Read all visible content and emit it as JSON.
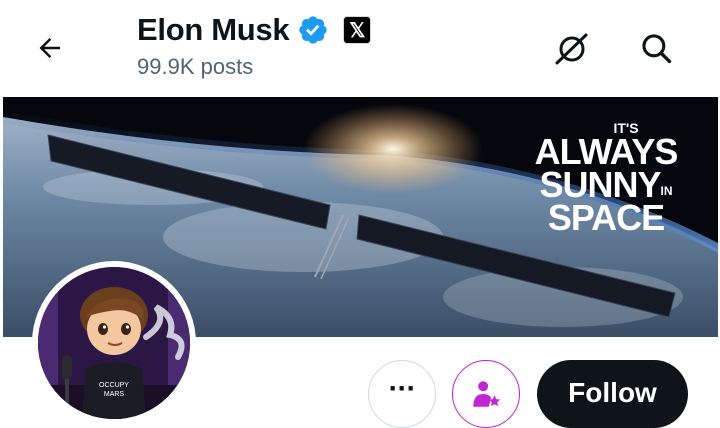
{
  "header": {
    "name": "Elon Musk",
    "posts": "99.9K posts",
    "x_badge": "𝕏"
  },
  "banner": {
    "line1": "IT'S",
    "line2": "ALWAYS",
    "line3": "SUNNY",
    "line3_small": "IN",
    "line4": "SPACE"
  },
  "actions": {
    "more": "···",
    "follow": "Follow"
  },
  "icons": {
    "back": "arrow-left-icon",
    "verified": "verified-badge-icon",
    "grok": "grok-icon",
    "search": "search-icon",
    "subscribe": "subscribe-star-person-icon"
  },
  "colors": {
    "verified": "#1d9bf0",
    "follow_bg": "#0f1419",
    "subscribe": "#c026d3",
    "muted_text": "#536471"
  }
}
